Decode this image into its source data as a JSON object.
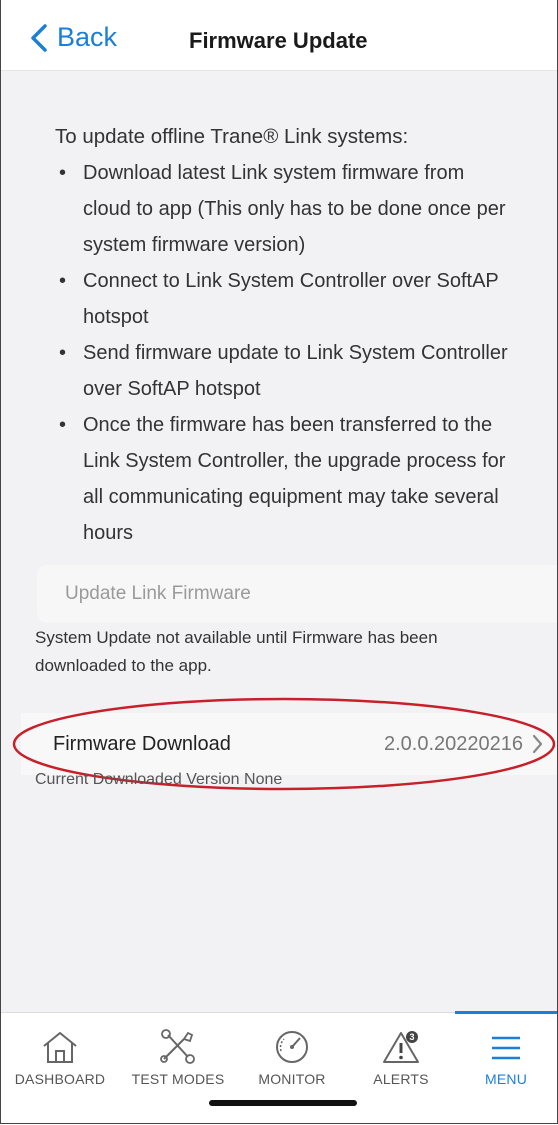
{
  "nav": {
    "back_label": "Back",
    "title": "Firmware Update"
  },
  "intro": {
    "heading": "To update offline Trane® Link systems:",
    "bullets": [
      "Download latest Link system firmware from cloud to app (This only has to be done once per system firmware version)",
      "Connect to Link System Controller over SoftAP hotspot",
      "Send firmware update to Link System Controller over SoftAP hotspot",
      "Once the firmware has been transferred to the Link System Controller, the upgrade process for all communicating equipment may take several hours"
    ]
  },
  "update_button": {
    "label": "Update Link Firmware"
  },
  "notice": "System Update not available until Firmware has been downloaded to the app.",
  "firmware_row": {
    "label": "Firmware Download",
    "version": "2.0.0.20220216"
  },
  "current_version": "Current Downloaded Version None",
  "tabs": [
    {
      "label": "DASHBOARD",
      "icon": "house-icon"
    },
    {
      "label": "TEST MODES",
      "icon": "tools-icon"
    },
    {
      "label": "MONITOR",
      "icon": "gauge-icon"
    },
    {
      "label": "ALERTS",
      "icon": "alert-triangle-icon",
      "badge": "3"
    },
    {
      "label": "MENU",
      "icon": "hamburger-menu-icon",
      "active": true
    }
  ],
  "colors": {
    "accent": "#1b7fd8",
    "highlight_oval": "#c8202a"
  }
}
